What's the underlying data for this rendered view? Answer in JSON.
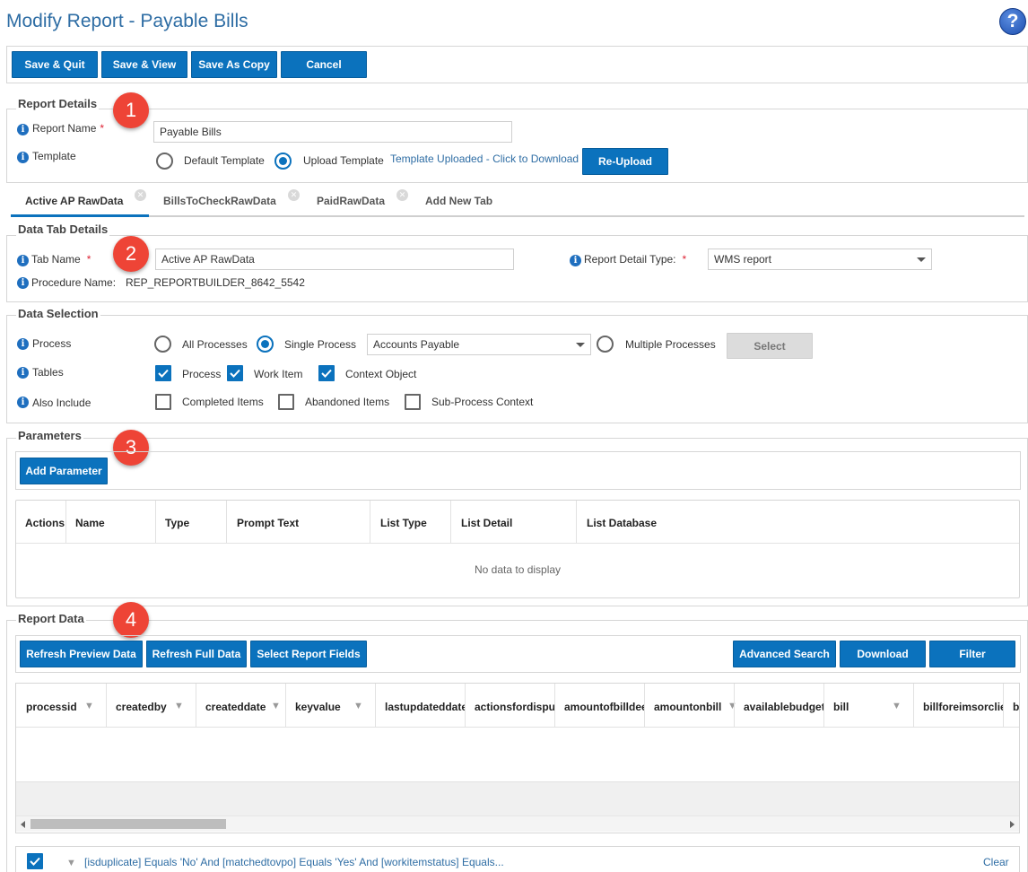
{
  "page": {
    "title": "Modify Report - Payable Bills",
    "help_icon": "question-icon"
  },
  "toolbar": {
    "save_quit": "Save & Quit",
    "save_view": "Save & View",
    "save_copy": "Save As Copy",
    "cancel": "Cancel"
  },
  "report_details": {
    "legend": "Report Details",
    "badge": "1",
    "name_label": "Report Name",
    "name_value": "Payable Bills",
    "template_label": "Template",
    "default_template": "Default Template",
    "upload_template": "Upload Template",
    "selected": "upload",
    "uploaded_link": "Template Uploaded - Click to Download",
    "reupload": "Re-Upload"
  },
  "tabs": [
    {
      "label": "Active AP RawData",
      "active": true
    },
    {
      "label": "BillsToCheckRawData",
      "active": false
    },
    {
      "label": "PaidRawData",
      "active": false
    },
    {
      "label": "Add New Tab",
      "active": false
    }
  ],
  "data_tab": {
    "legend": "Data Tab Details",
    "badge": "2",
    "tab_name_label": "Tab Name",
    "tab_name_value": "Active AP RawData",
    "procedure_label": "Procedure Name:",
    "procedure_value": "REP_REPORTBUILDER_8642_5542",
    "detail_type_label": "Report Detail Type:",
    "detail_type_value": "WMS report"
  },
  "data_selection": {
    "legend": "Data Selection",
    "process_label": "Process",
    "all_processes": "All Processes",
    "single_process": "Single Process",
    "process_value": "Accounts Payable",
    "multiple_processes": "Multiple Processes",
    "select_btn": "Select",
    "tables_label": "Tables",
    "tables": [
      "Process",
      "Work Item",
      "Context Object"
    ],
    "also_label": "Also Include",
    "also": [
      "Completed Items",
      "Abandoned Items",
      "Sub-Process Context"
    ]
  },
  "parameters": {
    "legend": "Parameters",
    "badge": "3",
    "add_btn": "Add Parameter",
    "columns": [
      "Actions",
      "Name",
      "Type",
      "Prompt Text",
      "List Type",
      "List Detail",
      "List Database"
    ],
    "empty": "No data to display"
  },
  "report_data": {
    "legend": "Report Data",
    "badge": "4",
    "refresh_preview": "Refresh Preview Data",
    "refresh_full": "Refresh Full Data",
    "select_fields": "Select Report Fields",
    "advanced_search": "Advanced Search",
    "download": "Download",
    "filter": "Filter",
    "columns": [
      "processid",
      "createdby",
      "createddate",
      "keyvalue",
      "lastupdateddate",
      "actionsfordispu",
      "amountofbilldee",
      "amountonbill",
      "availablebudget",
      "bill",
      "billforeimsorclie",
      "b"
    ],
    "filter_text": "[isduplicate] Equals 'No' And [matchedtovpo] Equals 'Yes' And [workitemstatus] Equals...",
    "clear": "Clear"
  },
  "colors": {
    "accent": "#0b72bd",
    "title": "#2e6da4",
    "badge": "#ee4436"
  }
}
